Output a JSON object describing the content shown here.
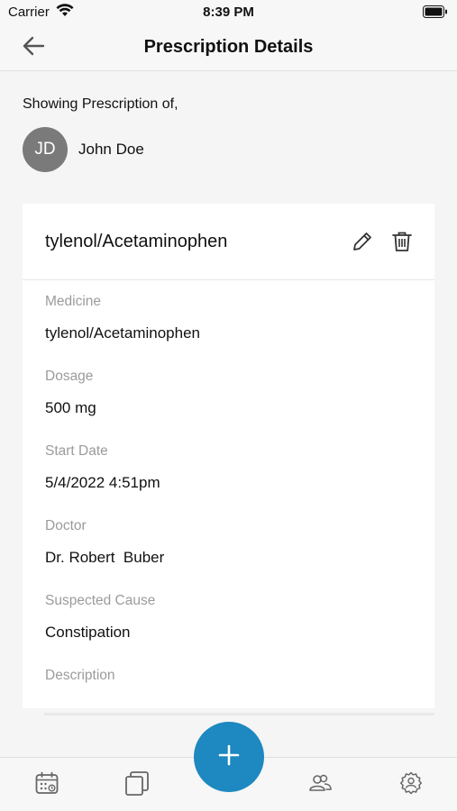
{
  "status_bar": {
    "carrier": "Carrier",
    "time": "8:39 PM"
  },
  "header": {
    "title": "Prescription Details",
    "back_icon": "arrow-left-icon"
  },
  "patient": {
    "label": "Showing Prescription of,",
    "initials": "JD",
    "name": "John Doe"
  },
  "prescription": {
    "title": "tylenol/Acetaminophen",
    "fields": [
      {
        "label": "Medicine",
        "value": "tylenol/Acetaminophen"
      },
      {
        "label": "Dosage",
        "value": "500 mg"
      },
      {
        "label": "Start Date",
        "value": "5/4/2022 4:51pm"
      },
      {
        "label": "Doctor",
        "value": "Dr. Robert  Buber"
      },
      {
        "label": "Suspected Cause",
        "value": "Constipation"
      },
      {
        "label": "Description",
        "value": ""
      }
    ]
  },
  "bottom_nav": {
    "tabs": [
      "calendar-icon",
      "pages-icon",
      "users-icon",
      "settings-icon"
    ],
    "fab_icon": "plus-icon"
  },
  "colors": {
    "accent": "#1e88c0",
    "avatar_bg": "#7a7a7a",
    "label_gray": "#9b9b9b"
  }
}
